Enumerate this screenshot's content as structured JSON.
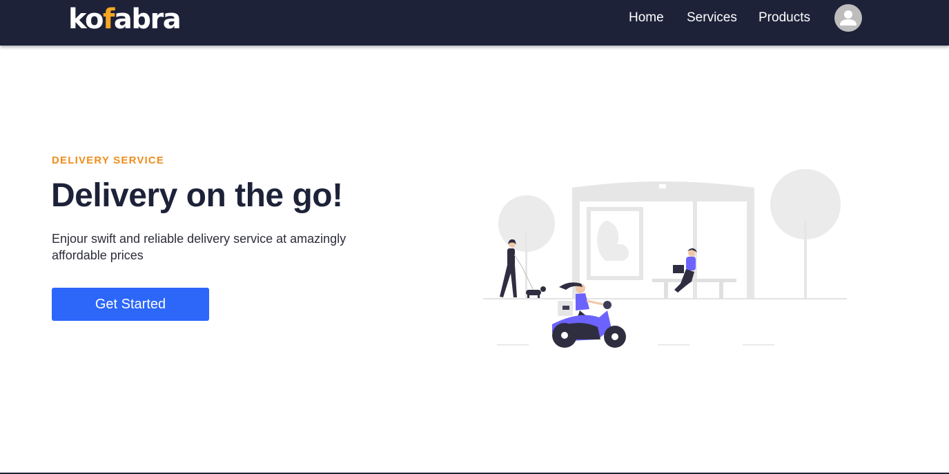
{
  "brand": {
    "logo_part1": "ko",
    "logo_accent": "f",
    "logo_part2": "abra",
    "primary_color": "#1d2239",
    "accent_color": "#f5a623"
  },
  "nav": {
    "links": [
      {
        "label": "Home"
      },
      {
        "label": "Services"
      },
      {
        "label": "Products"
      }
    ],
    "avatar_icon": "user-avatar-icon"
  },
  "hero": {
    "eyebrow": "DELIVERY SERVICE",
    "title": "Delivery on the go!",
    "description": "Enjour swift and reliable delivery service at amazingly affordable prices",
    "cta_label": "Get Started",
    "cta_color": "#2c67fa",
    "illustration_icon": "delivery-scooter-illustration"
  }
}
